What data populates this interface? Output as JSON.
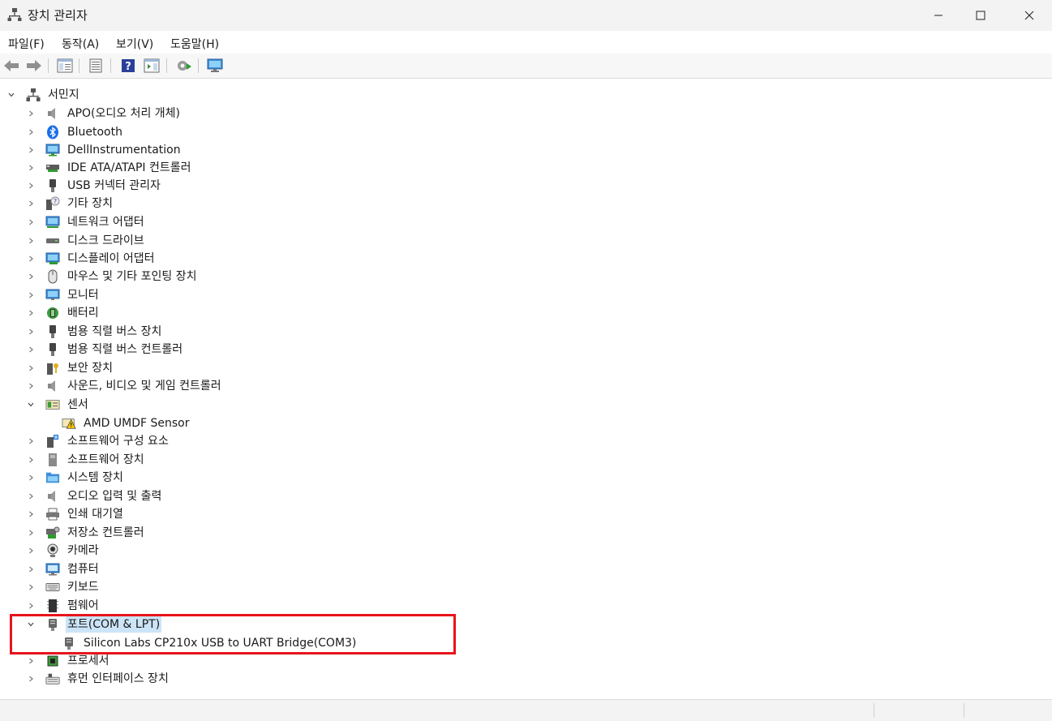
{
  "window": {
    "title": "장치 관리자",
    "icon": "device-manager-icon"
  },
  "menu": [
    "파일(F)",
    "동작(A)",
    "보기(V)",
    "도움말(H)"
  ],
  "toolbar_icons": [
    "back-arrow-icon",
    "forward-arrow-icon",
    "properties-pane-icon",
    "view-list-icon",
    "help-icon",
    "action-pane-icon",
    "update-driver-icon",
    "monitor-scan-icon"
  ],
  "tree": {
    "root": "서민지",
    "categories": [
      {
        "label": "APO(오디오 처리 개체)",
        "icon": "speaker-icon"
      },
      {
        "label": "Bluetooth",
        "icon": "bluetooth-icon"
      },
      {
        "label": "DellInstrumentation",
        "icon": "monitor-network-icon"
      },
      {
        "label": "IDE ATA/ATAPI 컨트롤러",
        "icon": "ide-controller-icon"
      },
      {
        "label": "USB 커넥터 관리자",
        "icon": "usb-plug-icon"
      },
      {
        "label": "기타 장치",
        "icon": "unknown-device-icon"
      },
      {
        "label": "네트워크 어댑터",
        "icon": "network-adapter-icon"
      },
      {
        "label": "디스크 드라이브",
        "icon": "disk-drive-icon"
      },
      {
        "label": "디스플레이 어댑터",
        "icon": "display-adapter-icon"
      },
      {
        "label": "마우스 및 기타 포인팅 장치",
        "icon": "mouse-icon"
      },
      {
        "label": "모니터",
        "icon": "monitor-icon"
      },
      {
        "label": "배터리",
        "icon": "battery-icon"
      },
      {
        "label": "범용 직렬 버스 장치",
        "icon": "usb-plug-icon"
      },
      {
        "label": "범용 직렬 버스 컨트롤러",
        "icon": "usb-plug-icon"
      },
      {
        "label": "보안 장치",
        "icon": "security-key-icon"
      },
      {
        "label": "사운드, 비디오 및 게임 컨트롤러",
        "icon": "speaker-icon"
      },
      {
        "label": "센서",
        "icon": "sensor-icon",
        "expanded": true,
        "children": [
          {
            "label": "AMD UMDF Sensor",
            "icon": "sensor-warning-icon"
          }
        ]
      },
      {
        "label": "소프트웨어 구성 요소",
        "icon": "software-component-icon"
      },
      {
        "label": "소프트웨어 장치",
        "icon": "software-device-icon"
      },
      {
        "label": "시스템 장치",
        "icon": "system-folder-icon"
      },
      {
        "label": "오디오 입력 및 출력",
        "icon": "speaker-icon"
      },
      {
        "label": "인쇄 대기열",
        "icon": "printer-icon"
      },
      {
        "label": "저장소 컨트롤러",
        "icon": "storage-controller-icon"
      },
      {
        "label": "카메라",
        "icon": "webcam-icon"
      },
      {
        "label": "컴퓨터",
        "icon": "computer-icon"
      },
      {
        "label": "키보드",
        "icon": "keyboard-icon"
      },
      {
        "label": "펌웨어",
        "icon": "firmware-chip-icon"
      },
      {
        "label": "포트(COM & LPT)",
        "icon": "port-icon",
        "expanded": true,
        "selected": true,
        "children": [
          {
            "label": "Silicon Labs CP210x USB to UART Bridge(COM3)",
            "icon": "port-icon"
          }
        ]
      },
      {
        "label": "프로세서",
        "icon": "processor-icon"
      },
      {
        "label": "휴먼 인터페이스 장치",
        "icon": "hid-icon"
      }
    ]
  },
  "colors": {
    "highlight_border": "#e8141b",
    "selection": "#cce4f7",
    "titlebar": "#f3f3f3"
  }
}
